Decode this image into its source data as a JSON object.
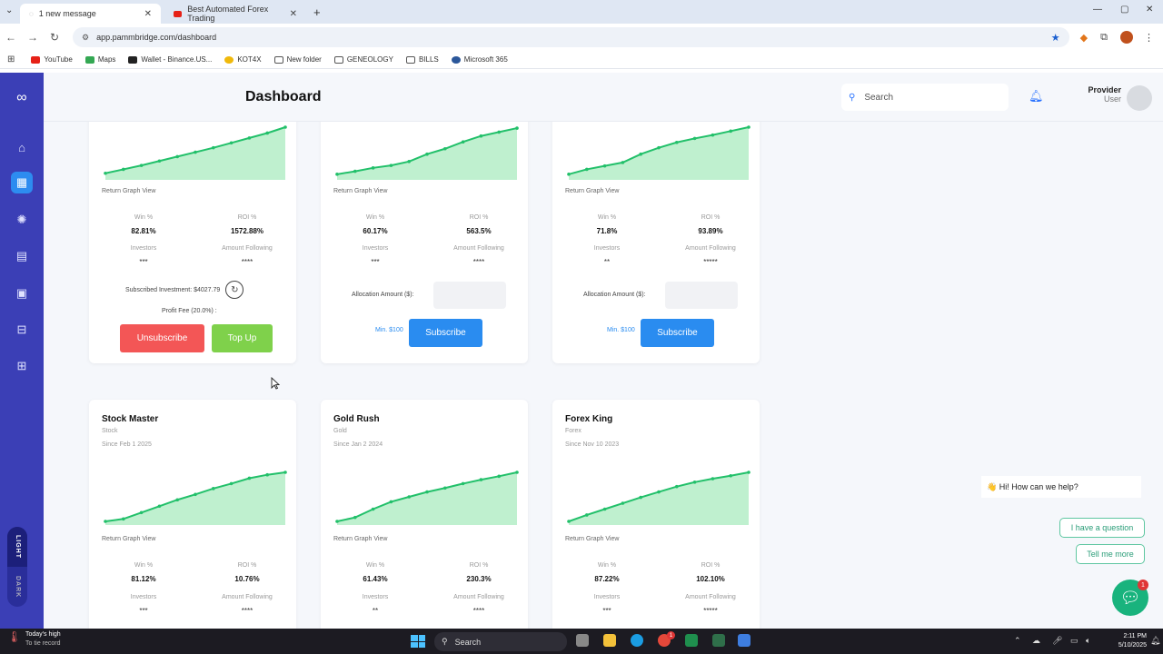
{
  "browser": {
    "tabs": [
      {
        "label": "1 new message",
        "active": true
      },
      {
        "label": "Best Automated Forex Trading",
        "active": false
      }
    ],
    "new_tab_icon": "plus-icon",
    "url": "app.pammbridge.com/dashboard",
    "bookmarks": [
      {
        "label": "YouTube",
        "icon": "youtube-icon",
        "color": "#e62117"
      },
      {
        "label": "Maps",
        "icon": "maps-icon",
        "color": "#34a853"
      },
      {
        "label": "Wallet - Binance.US...",
        "icon": "binance-icon",
        "color": "#222222"
      },
      {
        "label": "KOT4X",
        "icon": "kot4x-icon",
        "color": "#f0b90b"
      },
      {
        "label": "New folder",
        "icon": "folder-icon",
        "color": "#555555"
      },
      {
        "label": "GENEOLOGY",
        "icon": "folder-icon",
        "color": "#555555"
      },
      {
        "label": "BILLS",
        "icon": "folder-icon",
        "color": "#555555"
      },
      {
        "label": "Microsoft 365",
        "icon": "microsoft365-icon",
        "color": "#2b579a"
      }
    ]
  },
  "header": {
    "title": "Dashboard",
    "search_placeholder": "Search",
    "user_role": "Provider",
    "user_name": "User"
  },
  "sidebar": {
    "items": [
      {
        "name": "logo-icon"
      },
      {
        "name": "home-icon"
      },
      {
        "name": "chart-icon",
        "active": true
      },
      {
        "name": "settings-icon"
      },
      {
        "name": "document-icon"
      },
      {
        "name": "clipboard-icon"
      },
      {
        "name": "layout-icon"
      },
      {
        "name": "apps-icon"
      }
    ],
    "theme_light": "LIGHT",
    "theme_dark": "DARK"
  },
  "common": {
    "graph_label": "Return Graph View",
    "win_label": "Win %",
    "roi_label": "ROI %",
    "investors_label": "Investors",
    "amount_label": "Amount Following",
    "subscribed_label": "Subscribed Investment: $4027.79",
    "fee_label": "Profit Fee (20.0%) :",
    "unsubscribe": "Unsubscribe",
    "top_up": "Top Up",
    "alloc_label": "Allocation Amount ($):",
    "min_label": "Min. $100",
    "subscribe": "Subscribe"
  },
  "cards_top": [
    {
      "win": "82.81%",
      "roi": "1572.88%",
      "investors": "***",
      "amount": "****",
      "subscribed": true,
      "trend": [
        0.06,
        0.14,
        0.22,
        0.31,
        0.4,
        0.49,
        0.58,
        0.68,
        0.78,
        0.88,
        1.0
      ]
    },
    {
      "win": "60.17%",
      "roi": "563.5%",
      "investors": "***",
      "amount": "****",
      "subscribed": false,
      "trend": [
        0.04,
        0.1,
        0.17,
        0.22,
        0.3,
        0.45,
        0.56,
        0.7,
        0.82,
        0.9,
        0.98
      ]
    },
    {
      "win": "71.8%",
      "roi": "93.89%",
      "investors": "**",
      "amount": "*****",
      "subscribed": false,
      "trend": [
        0.04,
        0.14,
        0.21,
        0.28,
        0.45,
        0.58,
        0.69,
        0.77,
        0.84,
        0.92,
        1.0
      ]
    }
  ],
  "cards_bottom": [
    {
      "title": "Stock Master",
      "category": "Stock",
      "since": "Since Feb 1 2025",
      "win": "81.12%",
      "roi": "10.76%",
      "investors": "***",
      "amount": "****",
      "trend": [
        0.0,
        0.05,
        0.18,
        0.31,
        0.44,
        0.55,
        0.67,
        0.77,
        0.88,
        0.95,
        1.0
      ]
    },
    {
      "title": "Gold Rush",
      "category": "Gold",
      "since": "Since Jan 2 2024",
      "win": "61.43%",
      "roi": "230.3%",
      "investors": "**",
      "amount": "****",
      "trend": [
        0.0,
        0.08,
        0.25,
        0.4,
        0.5,
        0.6,
        0.68,
        0.77,
        0.85,
        0.92,
        1.0
      ]
    },
    {
      "title": "Forex King",
      "category": "Forex",
      "since": "Since Nov 10 2023",
      "win": "87.22%",
      "roi": "102.10%",
      "investors": "***",
      "amount": "*****",
      "trend": [
        0.0,
        0.13,
        0.25,
        0.37,
        0.49,
        0.6,
        0.71,
        0.8,
        0.87,
        0.93,
        1.0
      ]
    }
  ],
  "chat": {
    "prompt": "👋 Hi! How can we help?",
    "option1": "I have a question",
    "option2": "Tell me more",
    "badge": "1"
  },
  "taskbar": {
    "weather_title": "Today's high",
    "weather_sub": "To tie record",
    "search": "Search",
    "time": "2:11 PM",
    "date": "5/10/2025",
    "notification_badge": "1"
  },
  "colors": {
    "sidebar": "#3b3fb6",
    "accent_blue": "#2a8cf0",
    "unsubscribe_red": "#f35656",
    "topup_green": "#7fd14b",
    "graph_line": "#22c06a",
    "graph_fill": "#bff0cf"
  }
}
